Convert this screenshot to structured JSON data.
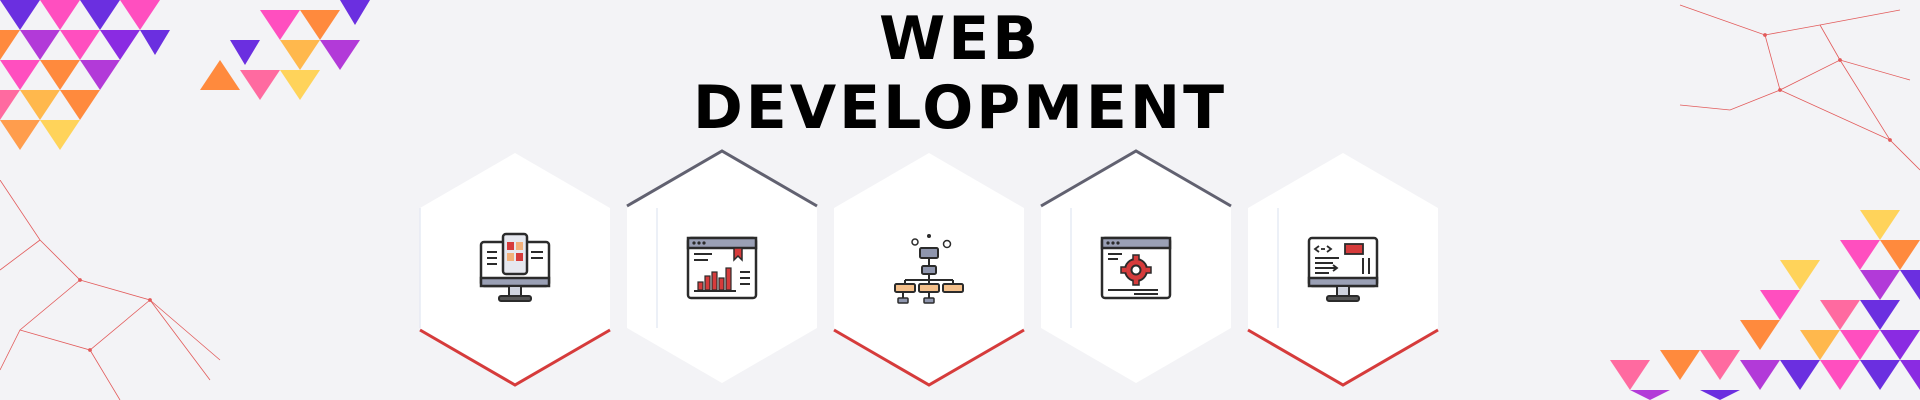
{
  "banner": {
    "title_line1": "WEB",
    "title_line2": "DEVELOPMENT"
  },
  "colors": {
    "background": "#f3f3f6",
    "accent_red": "#d63b3b",
    "accent_gray": "#616170",
    "deco_purple": "#6b2fe0",
    "deco_pink": "#ff4fbf",
    "deco_orange": "#ff8a3d",
    "deco_yellow": "#ffd35a"
  },
  "hexagons": [
    {
      "name": "hex-dashboard",
      "icon": "monitor-dashboard-icon",
      "edge": "bottom",
      "edge_color": "#d63b3b"
    },
    {
      "name": "hex-analytics",
      "icon": "browser-chart-icon",
      "edge": "top",
      "edge_color": "#616170"
    },
    {
      "name": "hex-sitemap",
      "icon": "sitemap-icon",
      "edge": "bottom",
      "edge_color": "#d63b3b"
    },
    {
      "name": "hex-settings",
      "icon": "browser-gear-icon",
      "edge": "top",
      "edge_color": "#616170"
    },
    {
      "name": "hex-code",
      "icon": "monitor-code-icon",
      "edge": "bottom",
      "edge_color": "#d63b3b"
    }
  ]
}
